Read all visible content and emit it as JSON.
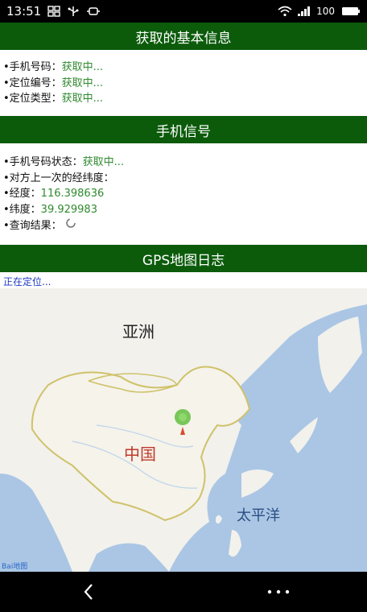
{
  "status_bar": {
    "time": "13:51",
    "battery_text": "100",
    "icons_left": [
      "grid-icon",
      "usb-icon",
      "debug-icon"
    ],
    "icons_right": [
      "wifi-icon",
      "signal-icon",
      "battery-icon"
    ]
  },
  "sections": {
    "basic_info": {
      "title": "获取的基本信息",
      "rows": [
        {
          "label": "•手机号码：",
          "value": "获取中..."
        },
        {
          "label": "•定位编号：",
          "value": "获取中..."
        },
        {
          "label": "•定位类型：",
          "value": "获取中..."
        }
      ]
    },
    "phone_signal": {
      "title": "手机信号",
      "rows": [
        {
          "label": "•手机号码状态：",
          "value": "获取中..."
        },
        {
          "label": "•对方上一次的经纬度：",
          "value": ""
        },
        {
          "label": "•经度：",
          "value": "116.398636"
        },
        {
          "label": "•纬度：",
          "value": "39.929983"
        },
        {
          "label": "•查询结果：",
          "value": ""
        }
      ]
    },
    "gps_log": {
      "title": "GPS地图日志",
      "status": "正在定位..."
    }
  },
  "map": {
    "labels": {
      "asia": "亚洲",
      "china": "中国",
      "pacific": "太平洋",
      "logo": "Bai地图"
    },
    "colors": {
      "sea": "#aac6e4",
      "land": "#f2f1ec",
      "border": "#cfc26a",
      "marker": "#6cc24a"
    }
  },
  "nav": {
    "back_icon": "back-icon",
    "menu_icon": "more-icon"
  }
}
